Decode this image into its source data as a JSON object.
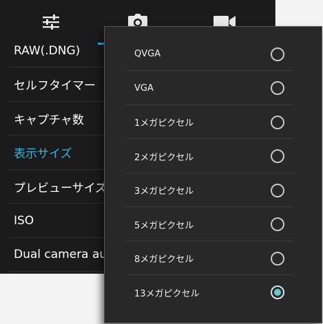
{
  "tabs": {
    "settings_icon": "sliders-icon",
    "photo_icon": "camera-icon",
    "video_icon": "video-camera-icon",
    "accent": "#33b5e5"
  },
  "settings": {
    "items": [
      {
        "label": "RAW(.DNG)"
      },
      {
        "label": "セルフタイマー"
      },
      {
        "label": "キャプチャ数"
      },
      {
        "label": "表示サイズ",
        "active": true
      },
      {
        "label": "プレビューサイズ"
      },
      {
        "label": "ISO"
      },
      {
        "label": "Dual camera auto"
      }
    ]
  },
  "popup": {
    "options": [
      {
        "label": "QVGA",
        "selected": false
      },
      {
        "label": "VGA",
        "selected": false
      },
      {
        "label": "1メガピクセル",
        "selected": false
      },
      {
        "label": "2メガピクセル",
        "selected": false
      },
      {
        "label": "3メガピクセル",
        "selected": false
      },
      {
        "label": "5メガピクセル",
        "selected": false
      },
      {
        "label": "8メガピクセル",
        "selected": false
      },
      {
        "label": "13メガピクセル",
        "selected": true
      }
    ]
  }
}
